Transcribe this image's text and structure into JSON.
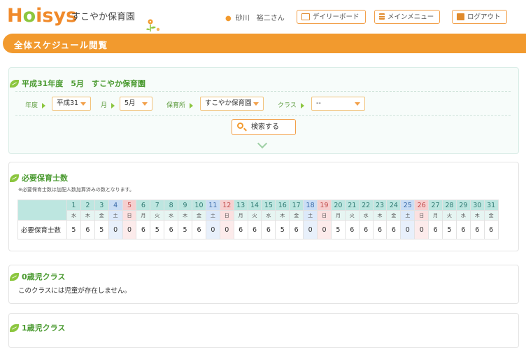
{
  "header": {
    "logo_parts": [
      "H",
      "o",
      "isys"
    ],
    "facility_name": "すこやか保育園",
    "user_name": "砂川　裕二さん",
    "buttons": {
      "daily_board": "デイリーボード",
      "main_menu": "メインメニュー",
      "logout": "ログアウト"
    }
  },
  "page_title": "全体スケジュール閲覧",
  "filter_panel": {
    "heading": "平成31年度　5月　すこやか保育園",
    "labels": {
      "year": "年度",
      "month": "月",
      "facility": "保育所",
      "class": "クラス"
    },
    "values": {
      "year": "平成31",
      "month": "5月",
      "facility": "すこやか保育園",
      "class": "--"
    },
    "search_label": "検索する"
  },
  "staff_panel": {
    "heading": "必要保育士数",
    "note": "※必要保育士数は加配人数加算済みの数となります。",
    "row_label": "必要保育士数",
    "days": [
      "1",
      "2",
      "3",
      "4",
      "5",
      "6",
      "7",
      "8",
      "9",
      "10",
      "11",
      "12",
      "13",
      "14",
      "15",
      "16",
      "17",
      "18",
      "19",
      "20",
      "21",
      "22",
      "23",
      "24",
      "25",
      "26",
      "27",
      "28",
      "29",
      "30",
      "31"
    ],
    "weekdays": [
      "水",
      "木",
      "金",
      "土",
      "日",
      "月",
      "火",
      "水",
      "木",
      "金",
      "土",
      "日",
      "月",
      "火",
      "水",
      "木",
      "金",
      "土",
      "日",
      "月",
      "火",
      "水",
      "木",
      "金",
      "土",
      "日",
      "月",
      "火",
      "水",
      "木",
      "金"
    ],
    "counts": [
      "5",
      "6",
      "5",
      "0",
      "0",
      "6",
      "5",
      "6",
      "5",
      "6",
      "0",
      "0",
      "6",
      "6",
      "6",
      "5",
      "6",
      "0",
      "0",
      "5",
      "6",
      "6",
      "6",
      "6",
      "0",
      "0",
      "6",
      "5",
      "6",
      "6",
      "6"
    ]
  },
  "class0_panel": {
    "heading": "0歳児クラス",
    "message": "このクラスには児童が存在しません。"
  },
  "class1_panel": {
    "heading": "1歳児クラス"
  },
  "colors": {
    "accent": "#f29a2e",
    "green": "#8cc63f",
    "teal": "#bde6e0"
  }
}
